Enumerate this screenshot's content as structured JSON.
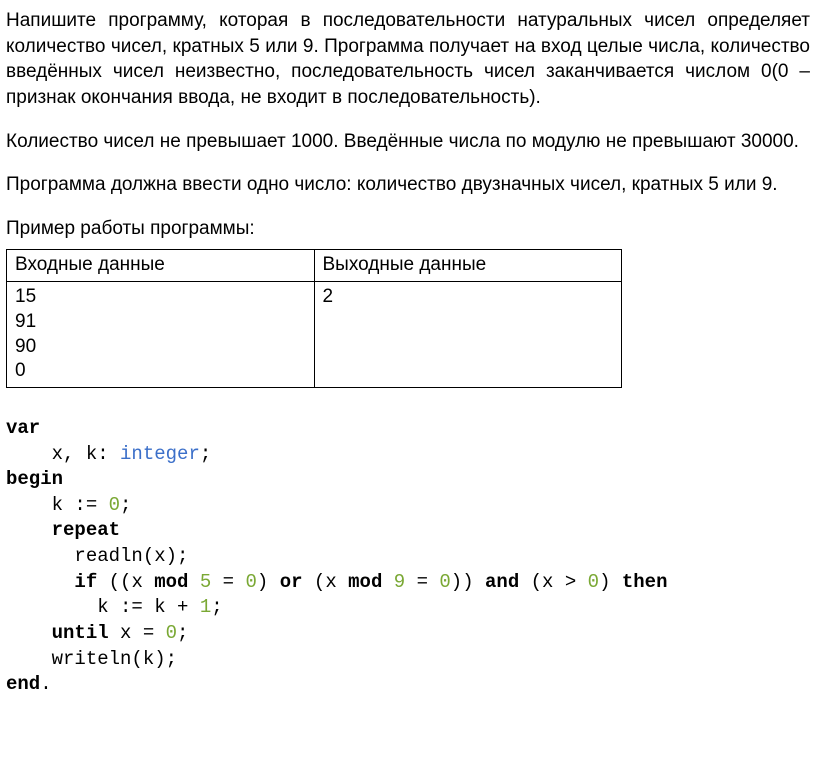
{
  "paragraphs": {
    "p1": "Напишите программу, которая в последовательности натуральных чисел определяет количество чисел, кратных 5 или 9. Программа получает на вход целые числа, количество введённых чисел неизвестно, последовательность чисел заканчивается числом 0(0 – признак окончания ввода, не входит в последовательность).",
    "p2": "Колиество чисел не превышает 1000. Введённые числа по модулю не превышают 30000.",
    "p3": "Программа должна ввести одно число: количество двузначных чисел, кратных 5 или 9.",
    "p4": "Пример работы программы:"
  },
  "table": {
    "header_in": "Входные данные",
    "header_out": "Выходные данные",
    "input_lines": "15\n91\n90\n0",
    "output_lines": "2"
  },
  "code": {
    "kw_var": "var",
    "decl_vars": "x, k: ",
    "type_integer": "integer",
    "semicolon1": ";",
    "kw_begin": "begin",
    "assign_prefix": "    k := ",
    "num_zero1": "0",
    "semicolon2": ";",
    "kw_repeat": "repeat",
    "readln": "      readln(x);",
    "if_pre": "      ",
    "kw_if": "if",
    "if_open": " ((x ",
    "kw_mod1": "mod",
    "sp1": " ",
    "num_5": "5",
    "eq1": " = ",
    "num_zero2": "0",
    "close1": ") ",
    "kw_or": "or",
    "open2": " (x ",
    "kw_mod2": "mod",
    "sp2": " ",
    "num_9": "9",
    "eq2": " = ",
    "num_zero3": "0",
    "close2": ")) ",
    "kw_and": "and",
    "open3": " (x > ",
    "num_zero4": "0",
    "close3": ") ",
    "kw_then": "then",
    "inc_line": "        k := k + ",
    "num_one": "1",
    "semicolon3": ";",
    "until_pre": "    ",
    "kw_until": "until",
    "until_cond": " x = ",
    "num_zero5": "0",
    "semicolon4": ";",
    "writeln": "    writeln(k);",
    "kw_end": "end",
    "dot": "."
  }
}
